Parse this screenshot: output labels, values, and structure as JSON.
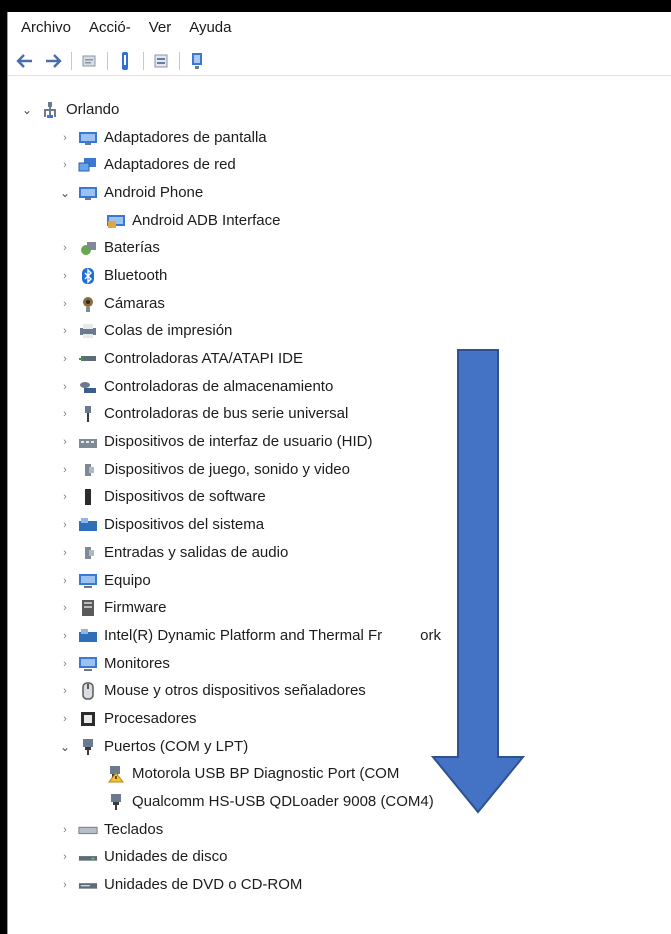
{
  "menu": {
    "items": [
      "Archivo",
      "Acció-",
      "Ver",
      "Ayuda"
    ]
  },
  "toolbar": {
    "icons": [
      "back-icon",
      "forward-icon",
      "properties-icon",
      "help-icon",
      "update-driver-icon",
      "monitor-icon"
    ]
  },
  "tree": {
    "root": "Orlando",
    "items": [
      {
        "label": "Adaptadores de pantalla",
        "icon": "display-adapter-icon",
        "level": 1,
        "state": "collapsed"
      },
      {
        "label": "Adaptadores de red",
        "icon": "network-adapter-icon",
        "level": 1,
        "state": "collapsed"
      },
      {
        "label": "Android Phone",
        "icon": "android-phone-icon",
        "level": 1,
        "state": "expanded"
      },
      {
        "label": "Android ADB Interface",
        "icon": "adb-interface-icon",
        "level": 2,
        "state": "leaf"
      },
      {
        "label": "Baterías",
        "icon": "battery-icon",
        "level": 1,
        "state": "collapsed"
      },
      {
        "label": "Bluetooth",
        "icon": "bluetooth-icon",
        "level": 1,
        "state": "collapsed"
      },
      {
        "label": "Cámaras",
        "icon": "camera-icon",
        "level": 1,
        "state": "collapsed"
      },
      {
        "label": "Colas de impresión",
        "icon": "print-queue-icon",
        "level": 1,
        "state": "collapsed"
      },
      {
        "label": "Controladoras ATA/ATAPI IDE",
        "icon": "ide-controller-icon",
        "level": 1,
        "state": "collapsed"
      },
      {
        "label": "Controladoras de almacenamiento",
        "icon": "storage-controller-icon",
        "level": 1,
        "state": "collapsed"
      },
      {
        "label": "Controladoras de bus serie universal",
        "icon": "usb-controller-icon",
        "level": 1,
        "state": "collapsed"
      },
      {
        "label": "Dispositivos de interfaz de usuario (HID)",
        "icon": "hid-icon",
        "level": 1,
        "state": "collapsed"
      },
      {
        "label": "Dispositivos de juego, sonido y video",
        "icon": "sound-icon",
        "level": 1,
        "state": "collapsed"
      },
      {
        "label": "Dispositivos de software",
        "icon": "software-device-icon",
        "level": 1,
        "state": "collapsed"
      },
      {
        "label": "Dispositivos del sistema",
        "icon": "system-device-icon",
        "level": 1,
        "state": "collapsed"
      },
      {
        "label": "Entradas y salidas de audio",
        "icon": "audio-io-icon",
        "level": 1,
        "state": "collapsed"
      },
      {
        "label": "Equipo",
        "icon": "computer-icon",
        "level": 1,
        "state": "collapsed"
      },
      {
        "label": "Firmware",
        "icon": "firmware-icon",
        "level": 1,
        "state": "collapsed"
      },
      {
        "label": "Intel(R) Dynamic Platform and Thermal Fr",
        "label_tail": "ork",
        "icon": "intel-platform-icon",
        "level": 1,
        "state": "collapsed"
      },
      {
        "label": "Monitores",
        "icon": "monitor-device-icon",
        "level": 1,
        "state": "collapsed"
      },
      {
        "label": "Mouse y otros dispositivos señaladores",
        "icon": "mouse-icon",
        "level": 1,
        "state": "collapsed"
      },
      {
        "label": "Procesadores",
        "icon": "processor-icon",
        "level": 1,
        "state": "collapsed"
      },
      {
        "label": "Puertos (COM y LPT)",
        "icon": "port-icon",
        "level": 1,
        "state": "expanded"
      },
      {
        "label": "Motorola USB BP Diagnostic Port (COM",
        "icon": "warning-port-icon",
        "level": 2,
        "state": "leaf"
      },
      {
        "label": "Qualcomm HS-USB QDLoader 9008 (COM4)",
        "icon": "port-icon",
        "level": 2,
        "state": "leaf"
      },
      {
        "label": "Teclados",
        "icon": "keyboard-icon",
        "level": 1,
        "state": "collapsed"
      },
      {
        "label": "Unidades de disco",
        "icon": "disk-drive-icon",
        "level": 1,
        "state": "collapsed"
      },
      {
        "label": "Unidades de DVD o CD-ROM",
        "icon": "dvd-drive-icon",
        "level": 1,
        "state": "collapsed"
      }
    ]
  },
  "annotation": {
    "arrow_color": "#4472c4",
    "arrow_outline": "#2f528f"
  }
}
